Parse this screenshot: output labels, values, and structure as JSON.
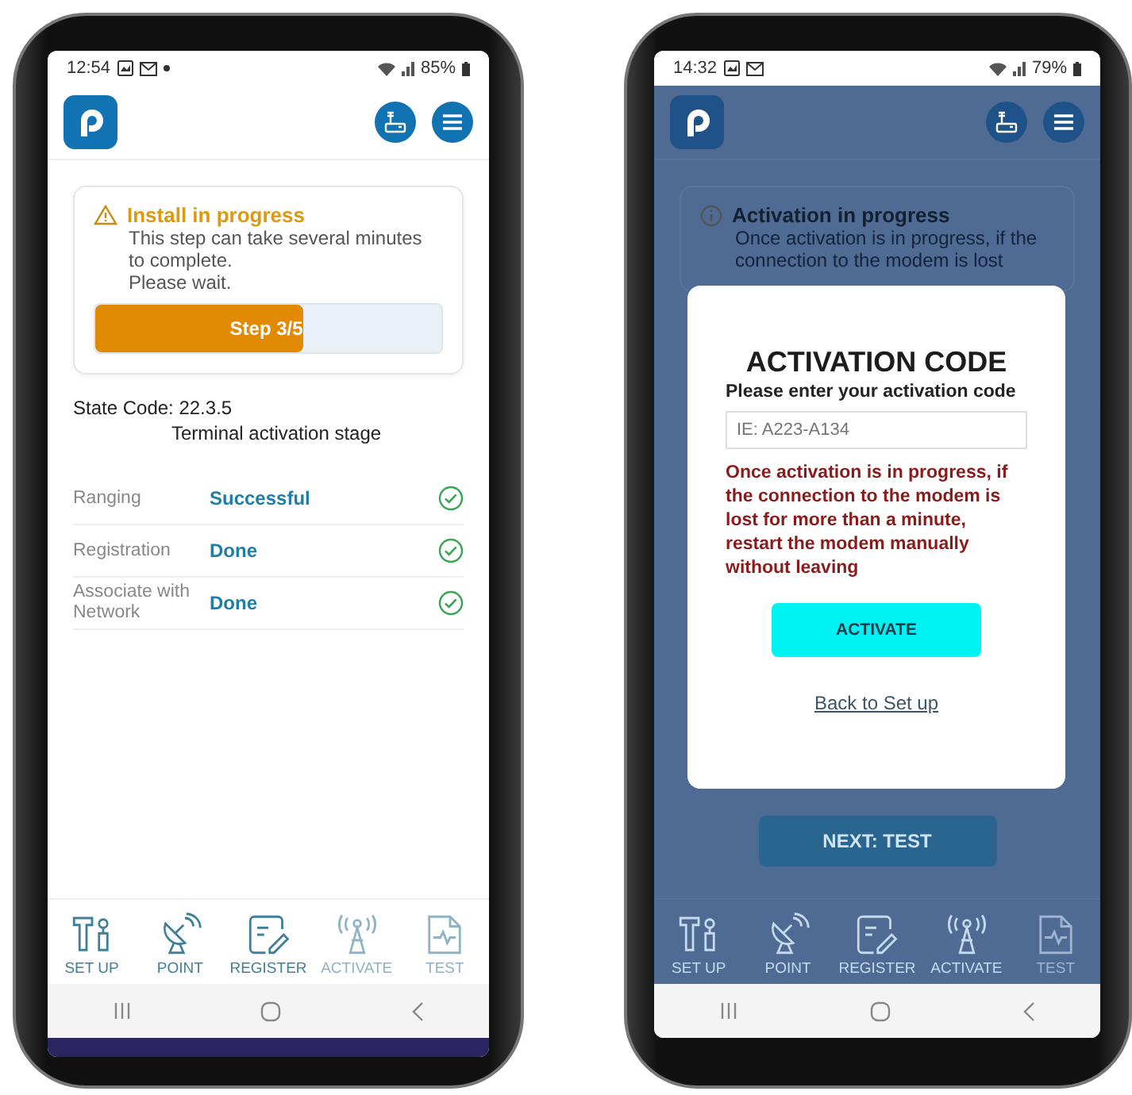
{
  "phones": [
    {
      "status_bar": {
        "time": "12:54",
        "notification_dot": true,
        "battery": "85%"
      },
      "dimmed": false,
      "alert": {
        "kind": "warning",
        "title": "Install in progress",
        "text": "This step can take several minutes to complete.",
        "note": "Please wait."
      },
      "progress": {
        "label": "Step 3/5",
        "level": 0.6
      },
      "state_code": {
        "label": "State Code: 22.3.5",
        "stage": "Terminal activation stage"
      },
      "rows": [
        {
          "label": "Ranging",
          "value": "Successful",
          "checked": true
        },
        {
          "label": "Registration",
          "value": "Done",
          "checked": true
        },
        {
          "label": "Associate with Network",
          "value": "Done",
          "checked": true
        }
      ],
      "bottom_nav": [
        {
          "label": "SET UP",
          "disabled": false
        },
        {
          "label": "POINT",
          "disabled": false
        },
        {
          "label": "REGISTER",
          "disabled": false
        },
        {
          "label": "ACTIVATE",
          "disabled": true
        },
        {
          "label": "TEST",
          "disabled": true
        }
      ]
    },
    {
      "status_bar": {
        "time": "14:32",
        "notification_dot": false,
        "battery": "79%"
      },
      "dimmed": true,
      "alert": {
        "kind": "info",
        "title": "Activation in progress",
        "text": "Once activation is in progress, if the connection to the modem is lost"
      },
      "next_button": "NEXT: TEST",
      "bottom_nav": [
        {
          "label": "SET UP",
          "disabled": false
        },
        {
          "label": "POINT",
          "disabled": false
        },
        {
          "label": "REGISTER",
          "disabled": false
        },
        {
          "label": "ACTIVATE",
          "disabled": false
        },
        {
          "label": "TEST",
          "disabled": true
        }
      ],
      "modal": {
        "title": "ACTIVATION CODE",
        "label": "Please enter your activation code",
        "placeholder": "IE: A223-A134",
        "warning": "Once activation is in progress, if the connection to the modem is lost for more than a minute, restart the modem manually without leaving",
        "button": "ACTIVATE",
        "link": "Back to Set up"
      }
    }
  ]
}
